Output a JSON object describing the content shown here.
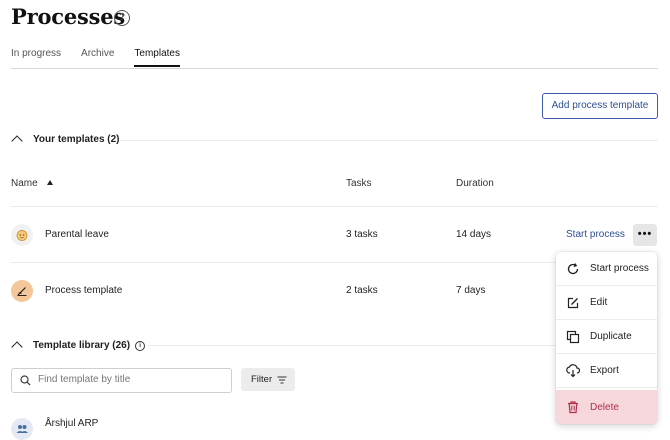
{
  "page": {
    "title": "Processes",
    "help_icon": "question-circle-icon"
  },
  "tabs": [
    {
      "label": "In progress"
    },
    {
      "label": "Archive"
    },
    {
      "label": "Templates",
      "active": true
    }
  ],
  "toolbar": {
    "add_template_label": "Add process template"
  },
  "your_templates": {
    "heading": "Your templates (2)",
    "columns": {
      "name": "Name",
      "tasks": "Tasks",
      "duration": "Duration"
    },
    "rows": [
      {
        "avatar": "baby-face-icon",
        "name": "Parental leave",
        "tasks": "3 tasks",
        "duration": "14 days",
        "action": "Start process"
      },
      {
        "avatar": "signature-pen-icon",
        "name": "Process template",
        "tasks": "2 tasks",
        "duration": "7 days"
      }
    ]
  },
  "library": {
    "heading": "Template library (26)",
    "search_placeholder": "Find template by title",
    "filter_label": "Filter",
    "rows": [
      {
        "avatar": "people-icon",
        "name": "Årshjul ARP"
      }
    ]
  },
  "context_menu": {
    "items": [
      {
        "label": "Start process",
        "icon": "refresh-icon"
      },
      {
        "label": "Edit",
        "icon": "edit-icon"
      },
      {
        "label": "Duplicate",
        "icon": "duplicate-icon"
      },
      {
        "label": "Export",
        "icon": "export-icon"
      },
      {
        "label": "Delete",
        "icon": "trash-icon"
      }
    ]
  },
  "colors": {
    "accent": "#2e4f94",
    "danger_bg": "#f6d7db",
    "danger_text": "#b0304a"
  }
}
